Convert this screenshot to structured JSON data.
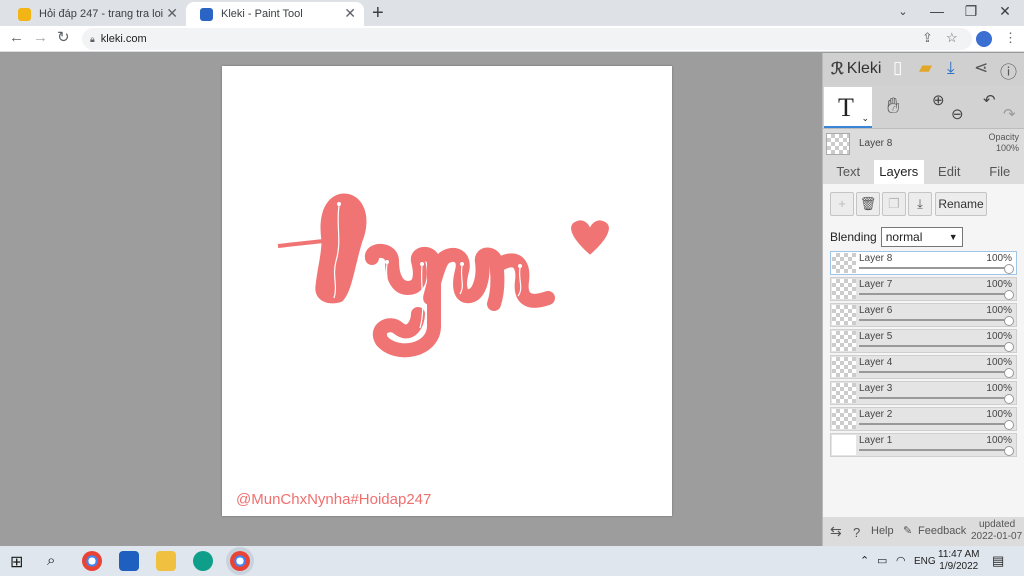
{
  "browser": {
    "tabs": [
      {
        "title": "Hỏi đáp 247 - trang tra loi"
      },
      {
        "title": "Kleki - Paint Tool"
      }
    ],
    "url": "kleki.com"
  },
  "canvas": {
    "drawing_text": "Lyn",
    "watermark": "@MunChxNynha#Hoidap247",
    "ink_color": "#f07474"
  },
  "app": {
    "brand": "Kleki",
    "current_layer": "Layer 8",
    "opacity_label": "Opacity",
    "opacity_value": "100%",
    "tabs": [
      "Text",
      "Layers",
      "Edit",
      "File"
    ],
    "rename_label": "Rename",
    "blending_label": "Blending",
    "blending_value": "normal",
    "layers": [
      {
        "name": "Layer 8",
        "opacity": "100%"
      },
      {
        "name": "Layer 7",
        "opacity": "100%"
      },
      {
        "name": "Layer 6",
        "opacity": "100%"
      },
      {
        "name": "Layer 5",
        "opacity": "100%"
      },
      {
        "name": "Layer 4",
        "opacity": "100%"
      },
      {
        "name": "Layer 3",
        "opacity": "100%"
      },
      {
        "name": "Layer 2",
        "opacity": "100%"
      },
      {
        "name": "Layer 1",
        "opacity": "100%"
      }
    ],
    "footer": {
      "help": "Help",
      "feedback": "Feedback",
      "updated_label": "updated",
      "updated_date": "2022-01-07"
    }
  },
  "taskbar": {
    "language": "ENG",
    "time": "11:47 AM",
    "date": "1/9/2022"
  }
}
